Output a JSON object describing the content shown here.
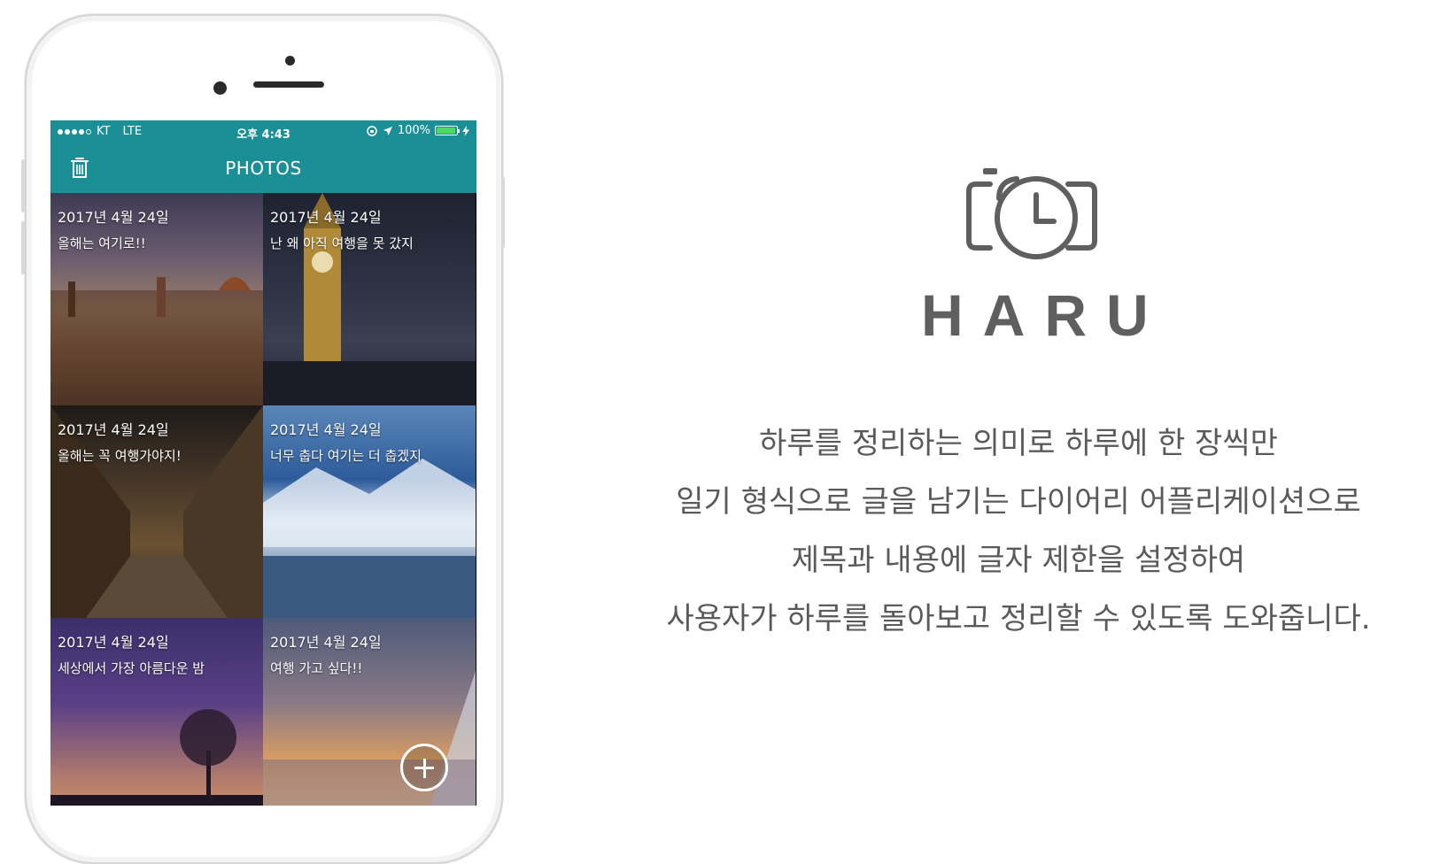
{
  "status_bar": {
    "carrier": "KT",
    "network": "LTE",
    "time": "오후 4:43",
    "battery": "100%"
  },
  "nav": {
    "title": "PHOTOS",
    "left_icon": "trash-icon"
  },
  "entries": [
    {
      "date": "2017년 4월 24일",
      "text": "올해는 여기로!!"
    },
    {
      "date": "2017년 4월 24일",
      "text": "난 왜 아직 여행을 못 갔지"
    },
    {
      "date": "2017년 4월 24일",
      "text": "올해는 꼭 여행가야지!"
    },
    {
      "date": "2017년 4월 24일",
      "text": "너무 춥다 여기는 더 춥겠지"
    },
    {
      "date": "2017년 4월 24일",
      "text": "세상에서 가장 아름다운 밤"
    },
    {
      "date": "2017년 4월 24일",
      "text": "여행 가고 싶다!!"
    }
  ],
  "app": {
    "name": "HARU",
    "description": [
      "하루를 정리하는 의미로 하루에 한 장씩만",
      "일기 형식으로 글을 남기는 다이어리 어플리케이션으로",
      "제목과 내용에 글자 제한을 설정하여",
      "사용자가 하루를 돌아보고 정리할 수 있도록 도와줍니다."
    ]
  },
  "colors": {
    "accent": "#1a8f96",
    "logo": "#5f5f5f",
    "text": "#5a5a5a"
  }
}
